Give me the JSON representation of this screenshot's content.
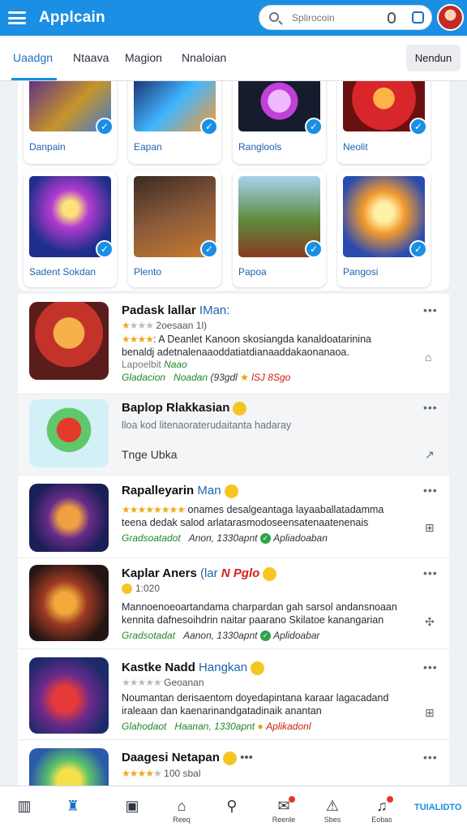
{
  "app": {
    "title": "Applcain"
  },
  "search": {
    "placeholder": "Splirocoin"
  },
  "tabs": [
    {
      "label": "Uaadgn",
      "active": true
    },
    {
      "label": "Ntaava"
    },
    {
      "label": "Magion"
    },
    {
      "label": "Nnaloian"
    }
  ],
  "tab_button": "Nendun",
  "cards": [
    {
      "label": "Danpain"
    },
    {
      "label": "Eapan"
    },
    {
      "label": "Ranglools"
    },
    {
      "label": "Neolit"
    },
    {
      "label": "Sadent Sokdan"
    },
    {
      "label": "Plento"
    },
    {
      "label": "Papoa"
    },
    {
      "label": "Pangosi"
    }
  ],
  "items": [
    {
      "title": "Padask lallar",
      "title_accent": "IMan:",
      "rating_text": "2oesaan 1l)",
      "desc1": ": A Deanlet Kanoon skosiangda kanaldoatarinina",
      "desc2": "benaldj adetnalenaaoddatiatdianaaddakaonanaoa.",
      "meta_grey": "Lapoelbit",
      "meta_green": "Naao",
      "meta1": "Gladacion",
      "meta2": "Noadan",
      "meta3": "(93gdl",
      "meta4": "lSJ 8Sgo"
    },
    {
      "title": "Baplop Rlakkasian",
      "desc1": "lloa kod litenaoraterudaitanta hadaray",
      "desc2": "Tnge Ubka"
    },
    {
      "title": "Rapalleyarin",
      "title_accent": "Man",
      "desc1": "onames desalgeantaga layaaballatadamma",
      "desc2": "teena dedak salod arlatarasmodoseensatenaatenenais",
      "meta1": "Gradsoatadot",
      "meta2": "Anon, 1330apnt",
      "meta3": "Apliadoaban"
    },
    {
      "title": "Kaplar Aners",
      "title_accent": "(lar",
      "title_red": "N Pglo",
      "rating_text": "1:020",
      "desc1": "Mannoenoeoartandama charpardan gah sarsol andansnoaan",
      "desc2": "kennita dafnesoihdrin naitar paarano Skilatoe kanangarian",
      "meta1": "Gradsotadat",
      "meta2": "Aanon, 1330apnt",
      "meta3": "Aplidoabar"
    },
    {
      "title": "Kastke Nadd",
      "title_accent": "Hangkan",
      "rating_text": "Geoanan",
      "desc1": "Noumantan derisaentom doyedapintana karaar lagacadand",
      "desc2": "iraleaan dan kaenarinandgatadinaik anantan",
      "meta1": "Glahodaot",
      "meta2": "Haanan, 1330apnt",
      "meta3": "Aplikadonl"
    },
    {
      "title": "Daagesi Netapan",
      "rating_text": "100 sbal"
    }
  ],
  "bottom_nav": [
    {
      "label": ""
    },
    {
      "label": ""
    },
    {
      "label": ""
    },
    {
      "label": "Reeq"
    },
    {
      "label": ""
    },
    {
      "label": "Reenle"
    },
    {
      "label": "Sbes"
    },
    {
      "label": "Eobas"
    }
  ],
  "bottom_label": "TUIALIDTO"
}
